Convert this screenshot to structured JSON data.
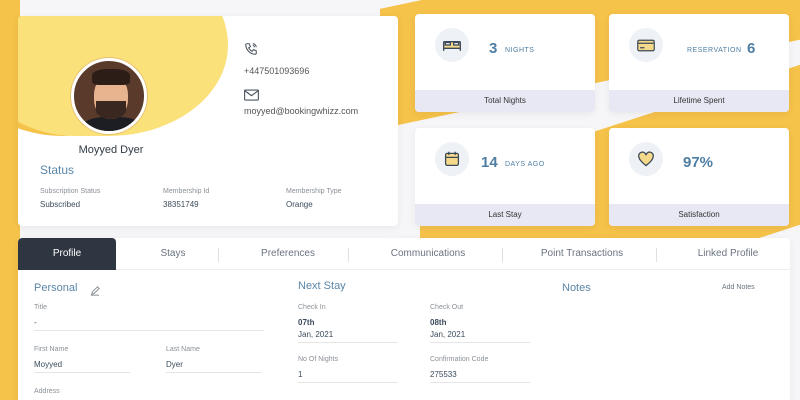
{
  "profile": {
    "name": "Moyyed Dyer",
    "phone": "+447501093696",
    "email": "moyyed@bookingwhizz.com"
  },
  "status": {
    "title": "Status",
    "fields": [
      {
        "label": "Subscription Status",
        "value": "Subscribed"
      },
      {
        "label": "Membership Id",
        "value": "38351749"
      },
      {
        "label": "Membership Type",
        "value": "Orange"
      }
    ]
  },
  "stats": [
    {
      "icon": "bed-icon",
      "value": "3",
      "unit": "NIGHTS",
      "footer": "Total Nights"
    },
    {
      "icon": "credit-card-icon",
      "value": "6",
      "unit": "RESERVATION",
      "footer": "Lifetime Spent"
    },
    {
      "icon": "calendar-icon",
      "value": "14",
      "unit": "DAYS AGO",
      "footer": "Last Stay"
    },
    {
      "icon": "heart-icon",
      "value": "97%",
      "unit": "",
      "footer": "Satisfaction"
    }
  ],
  "tabs": [
    {
      "label": "Profile",
      "active": true
    },
    {
      "label": "Stays"
    },
    {
      "label": "Preferences"
    },
    {
      "label": "Communications"
    },
    {
      "label": "Point Transactions"
    },
    {
      "label": "Linked Profile"
    }
  ],
  "personal": {
    "title": "Personal",
    "title_field": {
      "label": "Title",
      "value": "-"
    },
    "first_name": {
      "label": "First Name",
      "value": "Moyyed"
    },
    "last_name": {
      "label": "Last Name",
      "value": "Dyer"
    },
    "address": {
      "label": "Address"
    }
  },
  "next_stay": {
    "title": "Next Stay",
    "check_in": {
      "label": "Check In",
      "day": "07th",
      "month_year": "Jan, 2021"
    },
    "check_out": {
      "label": "Check Out",
      "day": "08th",
      "month_year": "Jan, 2021"
    },
    "nights": {
      "label": "No Of Nights",
      "value": "1"
    },
    "confirmation": {
      "label": "Confirmation Code",
      "value": "275533"
    }
  },
  "notes": {
    "title": "Notes",
    "add_label": "Add Notes"
  },
  "colors": {
    "accent_yellow": "#f5c24a",
    "accent_blue": "#4e7ea3",
    "tab_active": "#2e3641"
  }
}
